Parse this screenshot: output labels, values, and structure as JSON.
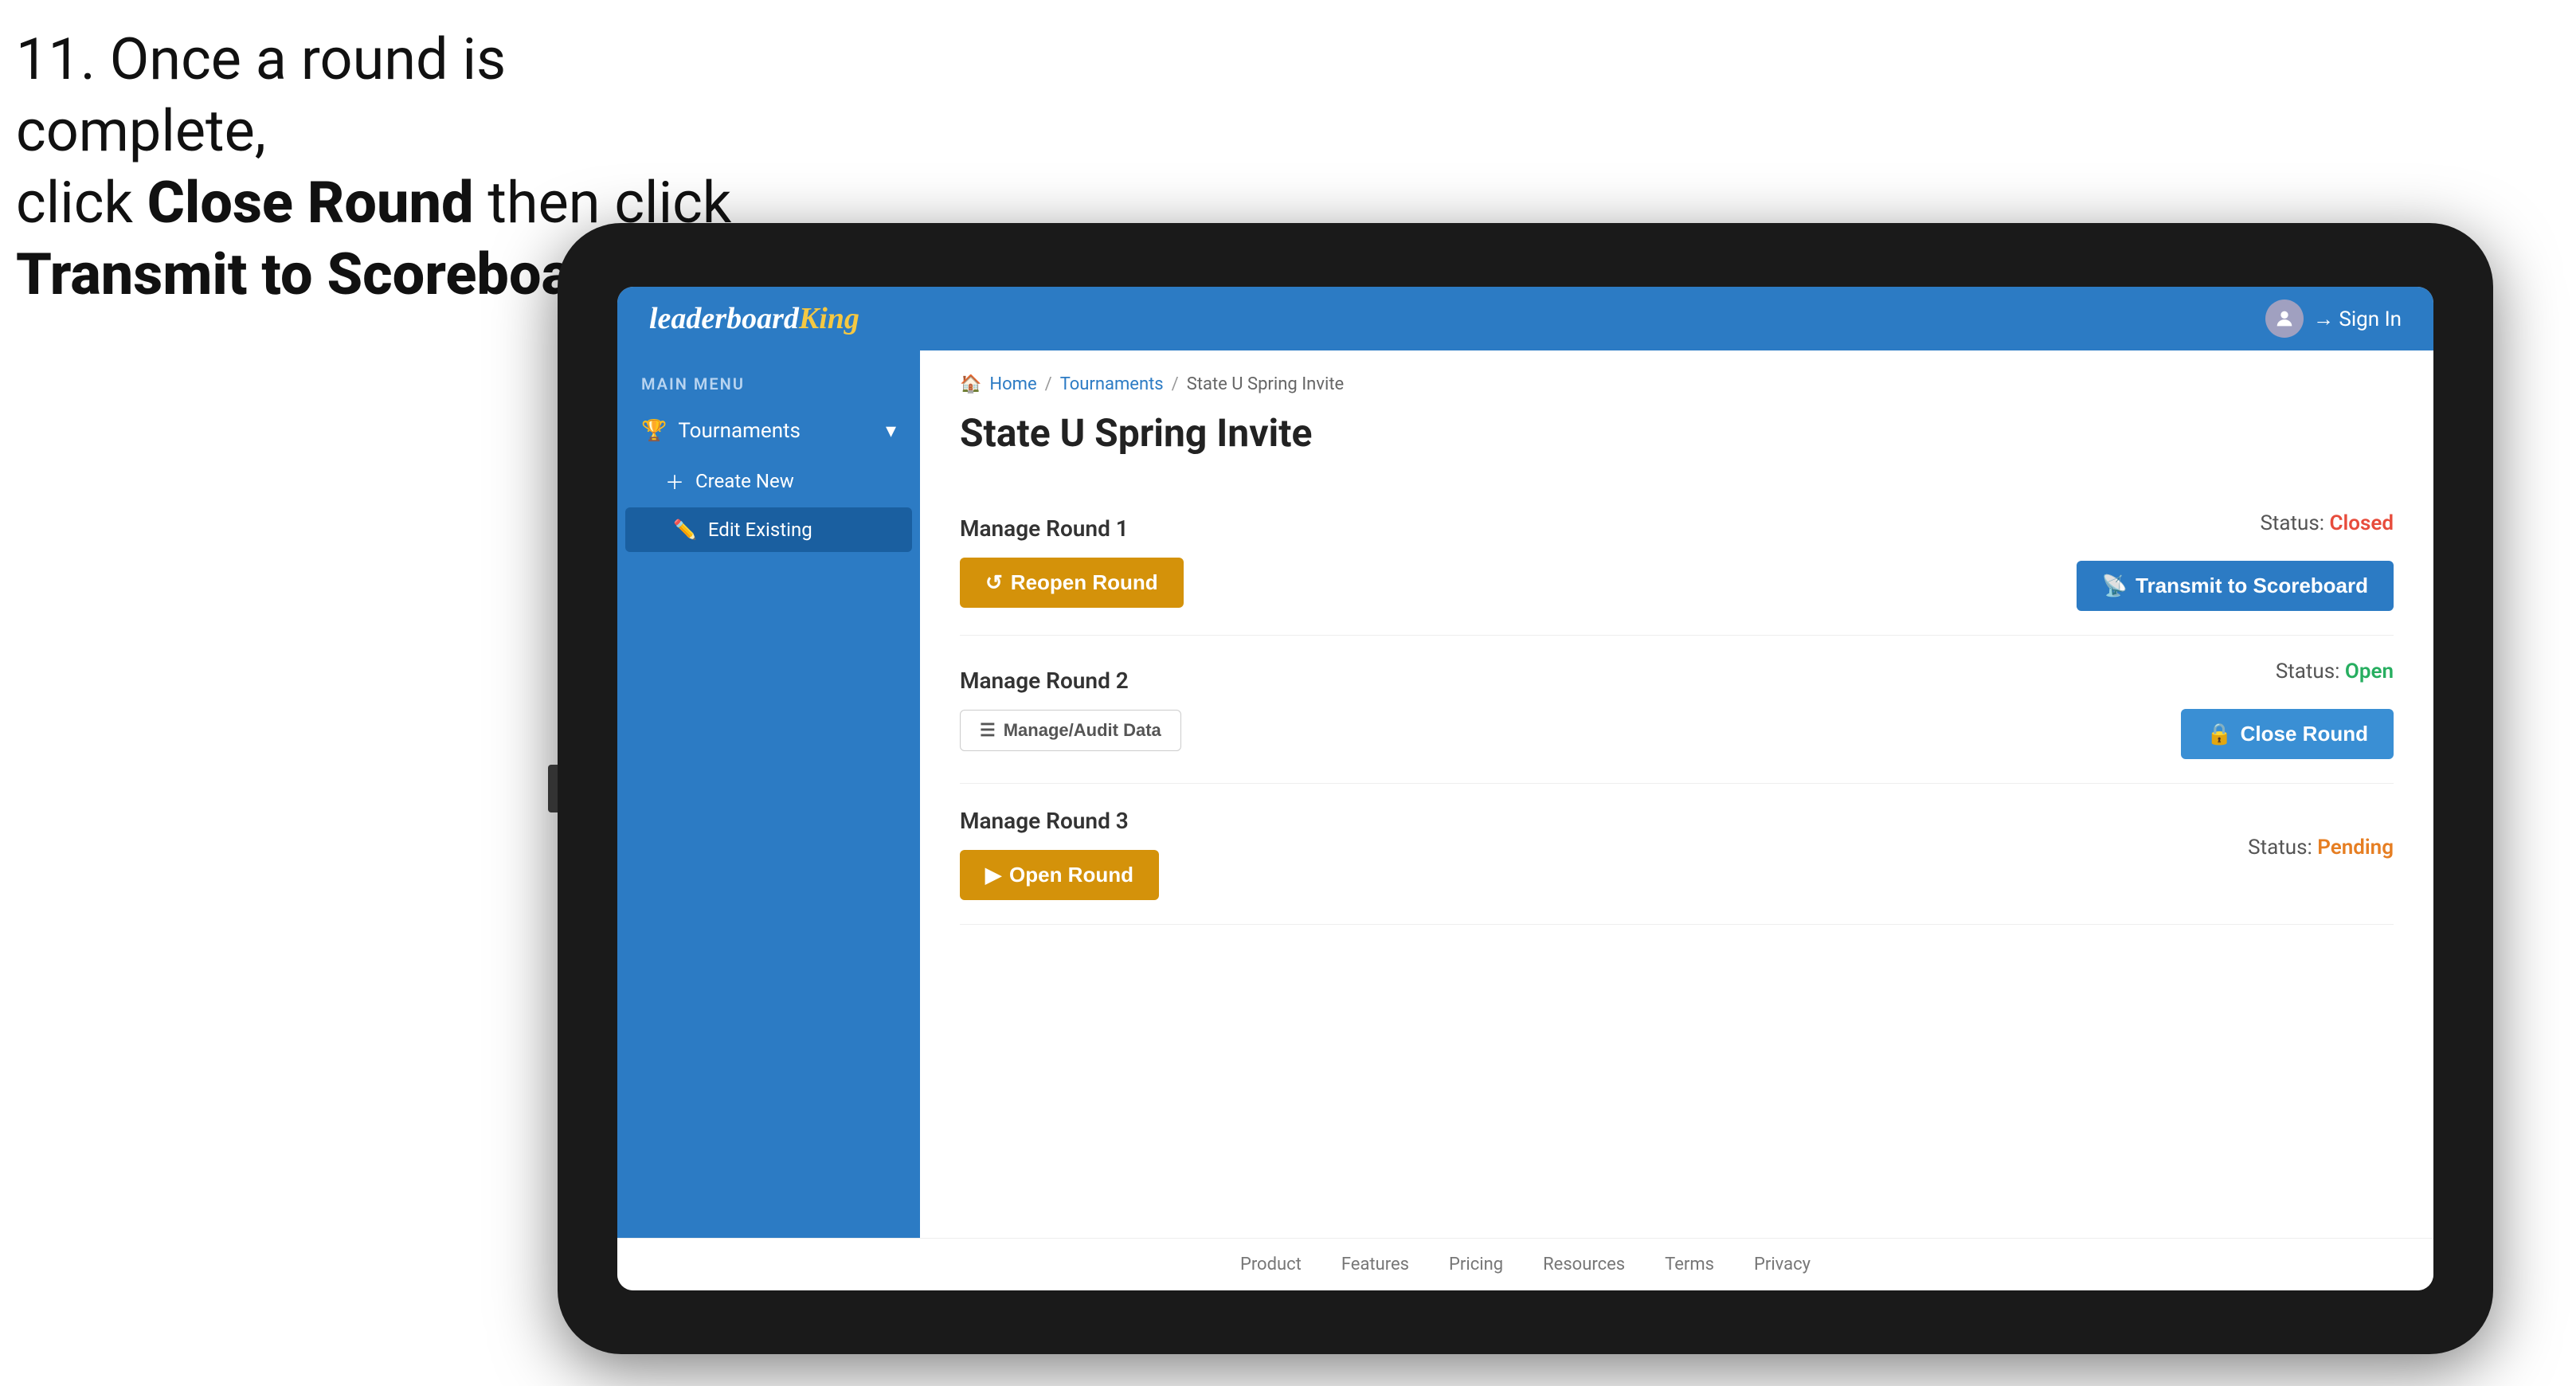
{
  "instruction": {
    "line1": "11. Once a round is complete,",
    "line2_prefix": "click ",
    "line2_bold": "Close Round",
    "line2_suffix": " then click",
    "line3_bold": "Transmit to Scoreboard."
  },
  "header": {
    "logo_normal": "leaderboard",
    "logo_styled": "King",
    "sign_in_label": "Sign In"
  },
  "sidebar": {
    "main_menu_label": "MAIN MENU",
    "tournaments_label": "Tournaments",
    "create_new_label": "Create New",
    "edit_existing_label": "Edit Existing"
  },
  "breadcrumb": {
    "home": "Home",
    "sep1": "/",
    "tournaments": "Tournaments",
    "sep2": "/",
    "current": "State U Spring Invite"
  },
  "page": {
    "title": "State U Spring Invite",
    "round1": {
      "label": "Manage Round 1",
      "status_prefix": "Status: ",
      "status_value": "Closed",
      "status_class": "status-closed",
      "reopen_btn": "Reopen Round",
      "transmit_btn": "Transmit to Scoreboard"
    },
    "round2": {
      "label": "Manage Round 2",
      "status_prefix": "Status: ",
      "status_value": "Open",
      "status_class": "status-open",
      "manage_btn": "Manage/Audit Data",
      "close_btn": "Close Round"
    },
    "round3": {
      "label": "Manage Round 3",
      "status_prefix": "Status: ",
      "status_value": "Pending",
      "status_class": "status-pending",
      "open_btn": "Open Round"
    }
  },
  "footer": {
    "links": [
      "Product",
      "Features",
      "Pricing",
      "Resources",
      "Terms",
      "Privacy"
    ]
  },
  "colors": {
    "blue": "#2c7bc4",
    "gold": "#d4920a",
    "red_arrow": "#e8174a"
  }
}
